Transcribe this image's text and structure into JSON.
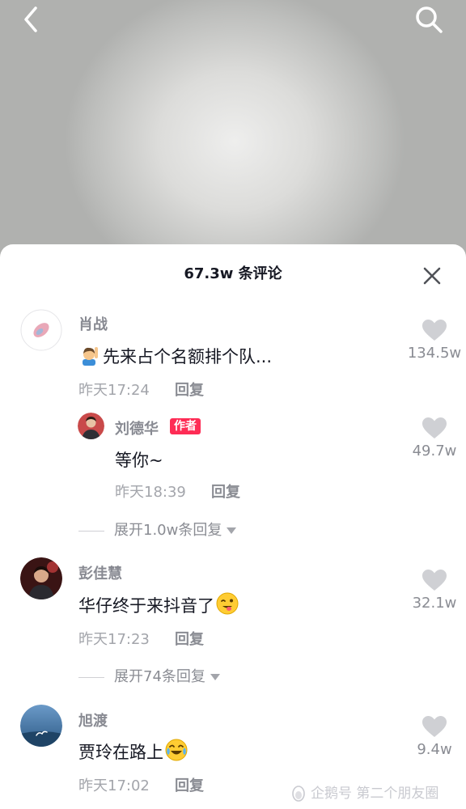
{
  "header": {
    "back_icon": "chevron-left-icon",
    "search_icon": "search-icon"
  },
  "sheet": {
    "title": "67.3w 条评论",
    "close_icon": "close-icon"
  },
  "comments": [
    {
      "user": "肖战",
      "text": "先来占个名额排个队...",
      "text_emoji": "raising-hand-person-emoji",
      "time": "昨天17:24",
      "reply_label": "回复",
      "likes": "134.5w",
      "reply": {
        "user": "刘德华",
        "badge": "作者",
        "text": "等你~",
        "time": "昨天18:39",
        "reply_label": "回复",
        "likes": "49.7w"
      },
      "expand_label": "展开1.0w条回复"
    },
    {
      "user": "彭佳慧",
      "text": "华仔终于来抖音了",
      "text_emoji": "wink-tongue-emoji",
      "time": "昨天17:23",
      "reply_label": "回复",
      "likes": "32.1w",
      "expand_label": "展开74条回复"
    },
    {
      "user": "旭渡",
      "text": "贾玲在路上",
      "text_emoji": "crying-laughing-emoji",
      "time": "昨天17:02",
      "reply_label": "回复",
      "likes": "9.4w"
    }
  ],
  "watermark": "企鹅号 第二个朋友圈",
  "colors": {
    "accent": "#fe2c55",
    "text_primary": "#161823",
    "text_secondary": "#8a8c93",
    "heart": "#cfd0d4"
  }
}
